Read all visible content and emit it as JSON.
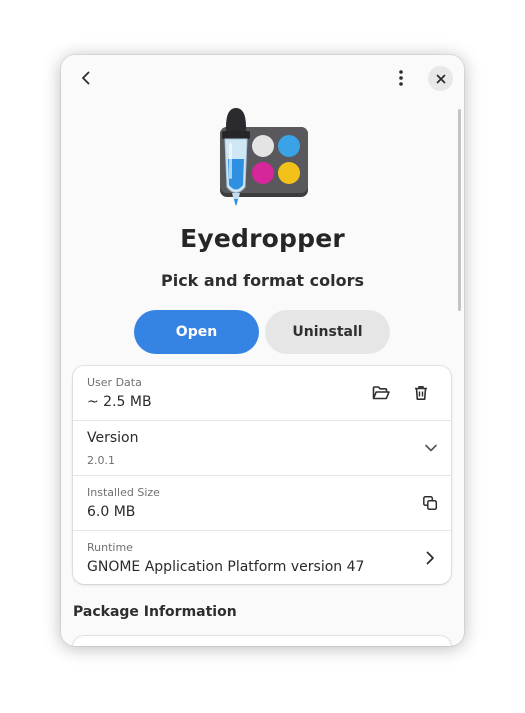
{
  "app": {
    "name": "Eyedropper",
    "summary": "Pick and format colors",
    "icon": "eyedropper-palette-icon"
  },
  "header": {
    "back_icon": "chevron-left-icon",
    "menu_icon": "vertical-dots-icon",
    "close_icon": "close-icon"
  },
  "actions": {
    "open_label": "Open",
    "uninstall_label": "Uninstall"
  },
  "details": {
    "user_data": {
      "label": "User Data",
      "value": "~ 2.5 MB"
    },
    "version": {
      "label": "Version",
      "value": "2.0.1"
    },
    "installed_size": {
      "label": "Installed Size",
      "value": "6.0 MB"
    },
    "runtime": {
      "label": "Runtime",
      "value": "GNOME Application Platform version 47"
    }
  },
  "sections": {
    "package_information": "Package Information"
  },
  "colors": {
    "accent": "#3584e4",
    "window_bg": "#fafafa",
    "card_bg": "#ffffff"
  }
}
